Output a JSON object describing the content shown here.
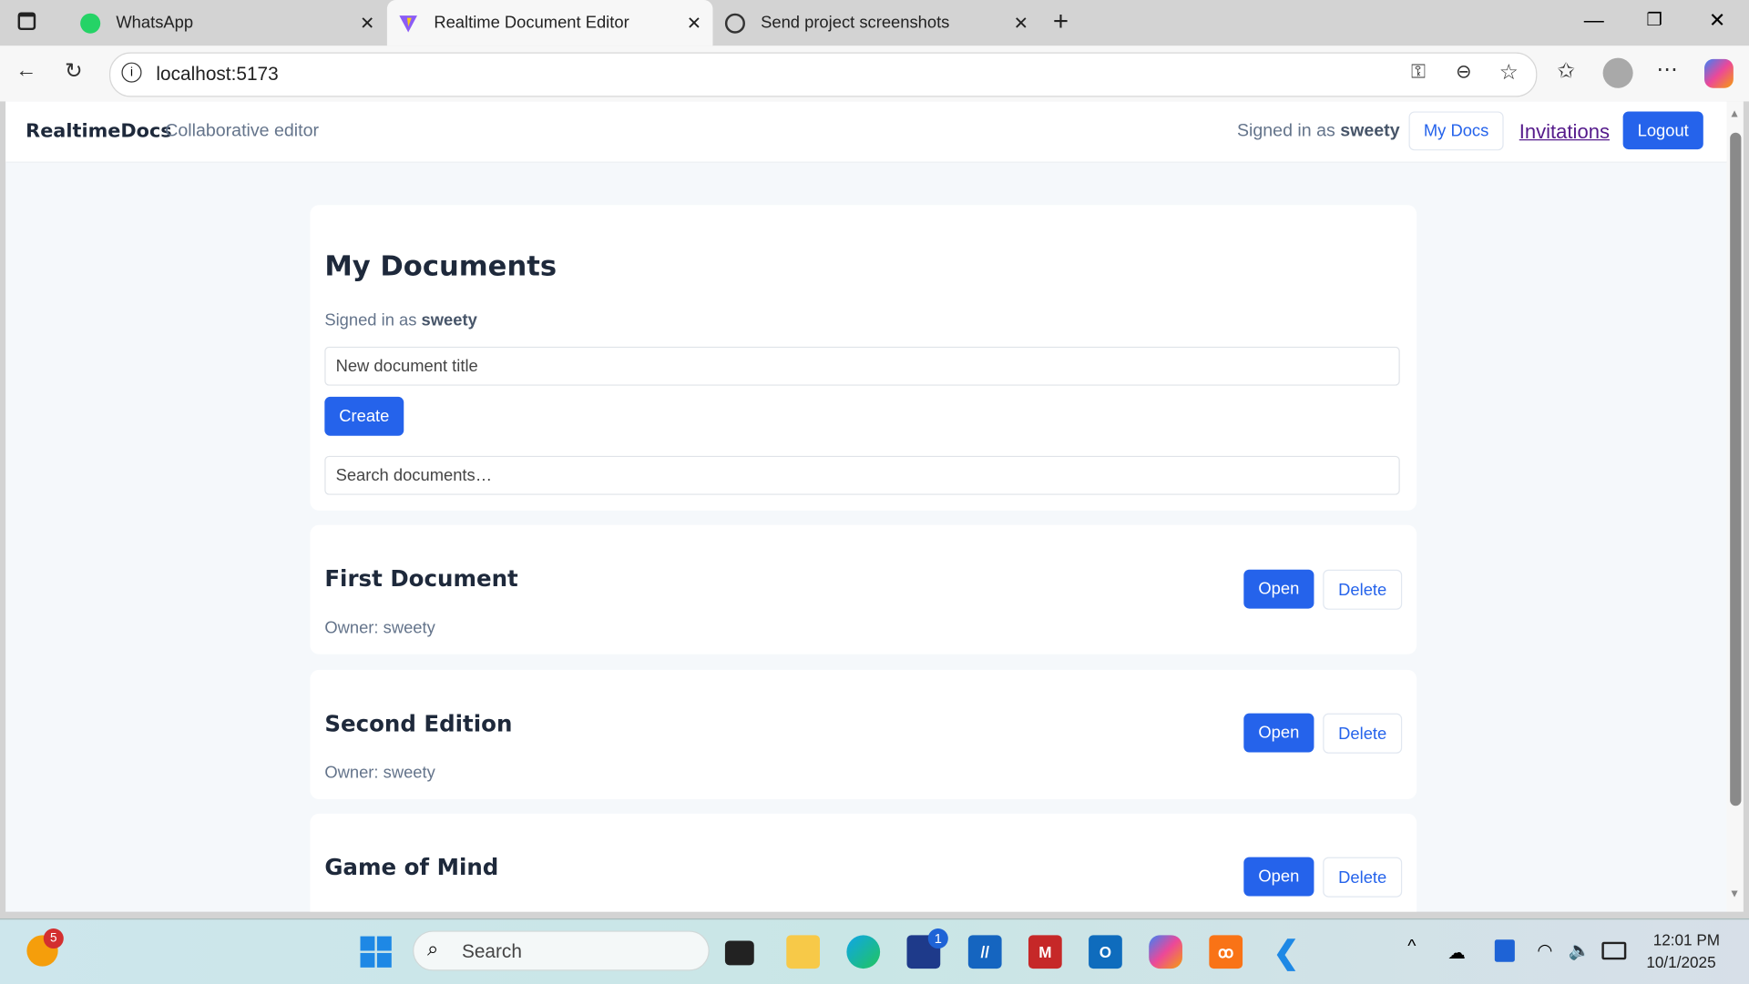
{
  "browser": {
    "tabs": [
      {
        "label": "WhatsApp",
        "icon": "whatsapp-icon",
        "active": false
      },
      {
        "label": "Realtime Document Editor",
        "icon": "vite-icon",
        "active": true
      },
      {
        "label": "Send project screenshots",
        "icon": "chatgpt-icon",
        "active": false
      }
    ],
    "url": "localhost:5173"
  },
  "app": {
    "brand": "RealtimeDocs",
    "tagline": "Collaborative editor",
    "signed_in_prefix": "Signed in as",
    "username": "sweety",
    "nav": {
      "my_docs": "My Docs",
      "invitations": "Invitations",
      "logout": "Logout"
    },
    "accent_color": "#2563eb"
  },
  "main": {
    "title": "My Documents",
    "signed_in_prefix": "Signed in as",
    "username": "sweety",
    "new_title_placeholder": "New document title",
    "create_label": "Create",
    "search_placeholder": "Search documents…",
    "documents": [
      {
        "title": "First Document",
        "owner": "Owner: sweety",
        "open": "Open",
        "delete": "Delete"
      },
      {
        "title": "Second Edition",
        "owner": "Owner: sweety",
        "open": "Open",
        "delete": "Delete"
      },
      {
        "title": "Game of Mind",
        "open": "Open",
        "delete": "Delete"
      }
    ]
  },
  "taskbar": {
    "search": "Search",
    "weather_badge": "5",
    "store_badge": "1",
    "time": "12:01 PM",
    "date": "10/1/2025"
  }
}
